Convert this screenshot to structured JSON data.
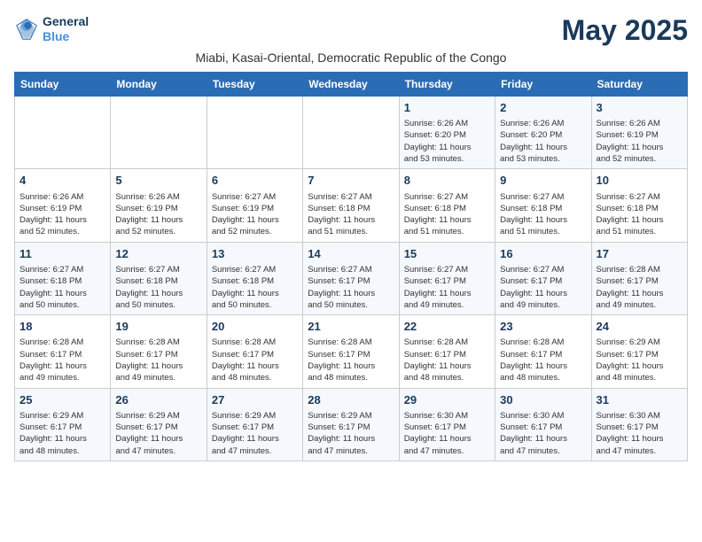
{
  "logo": {
    "line1": "General",
    "line2": "Blue"
  },
  "title": "May 2025",
  "subtitle": "Miabi, Kasai-Oriental, Democratic Republic of the Congo",
  "headers": [
    "Sunday",
    "Monday",
    "Tuesday",
    "Wednesday",
    "Thursday",
    "Friday",
    "Saturday"
  ],
  "weeks": [
    [
      {
        "day": "",
        "info": ""
      },
      {
        "day": "",
        "info": ""
      },
      {
        "day": "",
        "info": ""
      },
      {
        "day": "",
        "info": ""
      },
      {
        "day": "1",
        "info": "Sunrise: 6:26 AM\nSunset: 6:20 PM\nDaylight: 11 hours\nand 53 minutes."
      },
      {
        "day": "2",
        "info": "Sunrise: 6:26 AM\nSunset: 6:20 PM\nDaylight: 11 hours\nand 53 minutes."
      },
      {
        "day": "3",
        "info": "Sunrise: 6:26 AM\nSunset: 6:19 PM\nDaylight: 11 hours\nand 52 minutes."
      }
    ],
    [
      {
        "day": "4",
        "info": "Sunrise: 6:26 AM\nSunset: 6:19 PM\nDaylight: 11 hours\nand 52 minutes."
      },
      {
        "day": "5",
        "info": "Sunrise: 6:26 AM\nSunset: 6:19 PM\nDaylight: 11 hours\nand 52 minutes."
      },
      {
        "day": "6",
        "info": "Sunrise: 6:27 AM\nSunset: 6:19 PM\nDaylight: 11 hours\nand 52 minutes."
      },
      {
        "day": "7",
        "info": "Sunrise: 6:27 AM\nSunset: 6:18 PM\nDaylight: 11 hours\nand 51 minutes."
      },
      {
        "day": "8",
        "info": "Sunrise: 6:27 AM\nSunset: 6:18 PM\nDaylight: 11 hours\nand 51 minutes."
      },
      {
        "day": "9",
        "info": "Sunrise: 6:27 AM\nSunset: 6:18 PM\nDaylight: 11 hours\nand 51 minutes."
      },
      {
        "day": "10",
        "info": "Sunrise: 6:27 AM\nSunset: 6:18 PM\nDaylight: 11 hours\nand 51 minutes."
      }
    ],
    [
      {
        "day": "11",
        "info": "Sunrise: 6:27 AM\nSunset: 6:18 PM\nDaylight: 11 hours\nand 50 minutes."
      },
      {
        "day": "12",
        "info": "Sunrise: 6:27 AM\nSunset: 6:18 PM\nDaylight: 11 hours\nand 50 minutes."
      },
      {
        "day": "13",
        "info": "Sunrise: 6:27 AM\nSunset: 6:18 PM\nDaylight: 11 hours\nand 50 minutes."
      },
      {
        "day": "14",
        "info": "Sunrise: 6:27 AM\nSunset: 6:17 PM\nDaylight: 11 hours\nand 50 minutes."
      },
      {
        "day": "15",
        "info": "Sunrise: 6:27 AM\nSunset: 6:17 PM\nDaylight: 11 hours\nand 49 minutes."
      },
      {
        "day": "16",
        "info": "Sunrise: 6:27 AM\nSunset: 6:17 PM\nDaylight: 11 hours\nand 49 minutes."
      },
      {
        "day": "17",
        "info": "Sunrise: 6:28 AM\nSunset: 6:17 PM\nDaylight: 11 hours\nand 49 minutes."
      }
    ],
    [
      {
        "day": "18",
        "info": "Sunrise: 6:28 AM\nSunset: 6:17 PM\nDaylight: 11 hours\nand 49 minutes."
      },
      {
        "day": "19",
        "info": "Sunrise: 6:28 AM\nSunset: 6:17 PM\nDaylight: 11 hours\nand 49 minutes."
      },
      {
        "day": "20",
        "info": "Sunrise: 6:28 AM\nSunset: 6:17 PM\nDaylight: 11 hours\nand 48 minutes."
      },
      {
        "day": "21",
        "info": "Sunrise: 6:28 AM\nSunset: 6:17 PM\nDaylight: 11 hours\nand 48 minutes."
      },
      {
        "day": "22",
        "info": "Sunrise: 6:28 AM\nSunset: 6:17 PM\nDaylight: 11 hours\nand 48 minutes."
      },
      {
        "day": "23",
        "info": "Sunrise: 6:28 AM\nSunset: 6:17 PM\nDaylight: 11 hours\nand 48 minutes."
      },
      {
        "day": "24",
        "info": "Sunrise: 6:29 AM\nSunset: 6:17 PM\nDaylight: 11 hours\nand 48 minutes."
      }
    ],
    [
      {
        "day": "25",
        "info": "Sunrise: 6:29 AM\nSunset: 6:17 PM\nDaylight: 11 hours\nand 48 minutes."
      },
      {
        "day": "26",
        "info": "Sunrise: 6:29 AM\nSunset: 6:17 PM\nDaylight: 11 hours\nand 47 minutes."
      },
      {
        "day": "27",
        "info": "Sunrise: 6:29 AM\nSunset: 6:17 PM\nDaylight: 11 hours\nand 47 minutes."
      },
      {
        "day": "28",
        "info": "Sunrise: 6:29 AM\nSunset: 6:17 PM\nDaylight: 11 hours\nand 47 minutes."
      },
      {
        "day": "29",
        "info": "Sunrise: 6:30 AM\nSunset: 6:17 PM\nDaylight: 11 hours\nand 47 minutes."
      },
      {
        "day": "30",
        "info": "Sunrise: 6:30 AM\nSunset: 6:17 PM\nDaylight: 11 hours\nand 47 minutes."
      },
      {
        "day": "31",
        "info": "Sunrise: 6:30 AM\nSunset: 6:17 PM\nDaylight: 11 hours\nand 47 minutes."
      }
    ]
  ]
}
